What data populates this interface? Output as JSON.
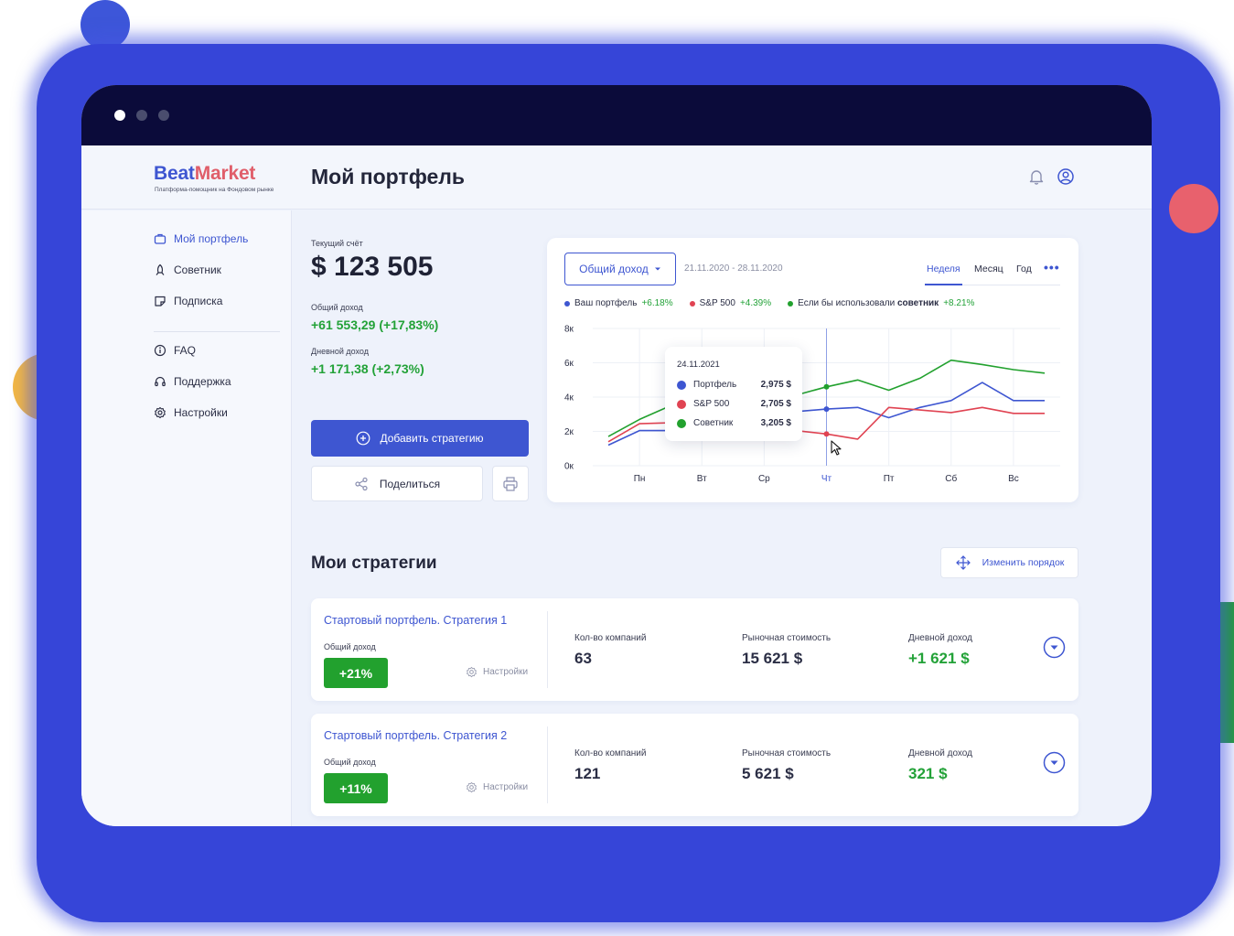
{
  "brand": {
    "name_part1": "Beat",
    "name_part2": "Market",
    "tagline": "Платформа-помощник на Фондовом рынке"
  },
  "header": {
    "title": "Мой портфель",
    "icons": [
      "bell-icon",
      "user-icon"
    ]
  },
  "sidebar": {
    "items": [
      {
        "label": "Мой портфель",
        "icon": "briefcase-icon",
        "active": true
      },
      {
        "label": "Советник",
        "icon": "rocket-icon",
        "active": false
      },
      {
        "label": "Подписка",
        "icon": "sticker-icon",
        "active": false
      },
      {
        "label": "FAQ",
        "icon": "info-icon",
        "active": false
      },
      {
        "label": "Поддержка",
        "icon": "headset-icon",
        "active": false
      },
      {
        "label": "Настройки",
        "icon": "gear-icon",
        "active": false
      }
    ]
  },
  "account": {
    "current_label": "Текущий счёт",
    "current_value": "$ 123 505",
    "total_label": "Общий доход",
    "total_value": "+61 553,29 (+17,83%)",
    "daily_label": "Дневной доход",
    "daily_value": "+1 171,38 (+2,73%)"
  },
  "actions": {
    "add_strategy": "Добавить стратегию",
    "share": "Поделиться"
  },
  "chart_panel": {
    "dropdown_label": "Общий доход",
    "date_range": "21.11.2020 - 28.11.2020",
    "tabs": [
      {
        "label": "Неделя",
        "active": true
      },
      {
        "label": "Месяц",
        "active": false
      },
      {
        "label": "Год",
        "active": false
      }
    ],
    "more": "•••",
    "legend": [
      {
        "label": "Ваш портфель",
        "pct": "+6.18%",
        "color": "#3e56d1"
      },
      {
        "label": "S&P 500",
        "pct": "+4.39%",
        "color": "#e04352"
      },
      {
        "label_prefix": "Если бы использовали ",
        "label_bold": "советник",
        "pct": "+8.21%",
        "color": "#22a12e"
      }
    ],
    "tooltip": {
      "date": "24.11.2021",
      "rows": [
        {
          "label": "Портфель",
          "value": "2,975 $",
          "color": "#3e56d1"
        },
        {
          "label": "S&P 500",
          "value": "2,705 $",
          "color": "#e04352"
        },
        {
          "label": "Советник",
          "value": "3,205 $",
          "color": "#22a12e"
        }
      ]
    }
  },
  "chart_data": {
    "type": "line",
    "categories": [
      "Пн",
      "Вт",
      "Ср",
      "Чт",
      "Пт",
      "Сб",
      "Вс"
    ],
    "y_ticks": [
      "0к",
      "2к",
      "4к",
      "6к",
      "8к"
    ],
    "ylim": [
      0,
      8000
    ],
    "highlighted_category": "Чт",
    "grid": true,
    "series": [
      {
        "name": "Портфель",
        "color": "#3e56d1",
        "x": [
          -0.5,
          0,
          0.5,
          1,
          1.5,
          2,
          2.5,
          3,
          3.5,
          4,
          4.5,
          5,
          5.5,
          6,
          6.5
        ],
        "values": [
          1200,
          2050,
          2050,
          1800,
          3450,
          2950,
          3150,
          3300,
          3400,
          2800,
          3400,
          3800,
          4850,
          3800,
          3800
        ]
      },
      {
        "name": "S&P 500",
        "color": "#e04352",
        "x": [
          -0.5,
          0,
          0.5,
          1,
          1.5,
          2,
          2.5,
          3,
          3.5,
          4,
          4.5,
          5,
          5.5,
          6,
          6.5
        ],
        "values": [
          1400,
          2450,
          2500,
          2450,
          2050,
          2250,
          2050,
          1850,
          1550,
          3400,
          3250,
          3100,
          3400,
          3050,
          3050
        ]
      },
      {
        "name": "Советник",
        "color": "#22a12e",
        "x": [
          -0.5,
          0,
          0.5,
          1,
          1.5,
          2,
          2.5,
          3,
          3.5,
          4,
          4.5,
          5,
          5.5,
          6,
          6.5
        ],
        "values": [
          1700,
          2700,
          3500,
          3500,
          3250,
          3900,
          4100,
          4600,
          5000,
          4400,
          5100,
          6150,
          5900,
          5600,
          5400
        ]
      }
    ]
  },
  "strategies": {
    "title": "Мои стратегии",
    "reorder_label": "Изменить порядок",
    "items": [
      {
        "name": "Стартовый портфель. Стратегия 1",
        "income_label": "Общий доход",
        "income_badge": "+21%",
        "settings_label": "Настройки",
        "companies_label": "Кол-во компаний",
        "companies_value": "63",
        "market_label": "Рыночная стоимость",
        "market_value": "15 621 $",
        "daily_label": "Дневной доход",
        "daily_value": "+1 621 $"
      },
      {
        "name": "Стартовый портфель. Стратегия 2",
        "income_label": "Общий доход",
        "income_badge": "+11%",
        "settings_label": "Настройки",
        "companies_label": "Кол-во компаний",
        "companies_value": "121",
        "market_label": "Рыночная стоимость",
        "market_value": "5 621 $",
        "daily_label": "Дневной доход",
        "daily_value": "321 $"
      }
    ]
  },
  "colors": {
    "accent": "#3e56d1",
    "positive": "#23a238",
    "brand_red": "#e05e6a",
    "titlebar": "#0b0b3a"
  }
}
